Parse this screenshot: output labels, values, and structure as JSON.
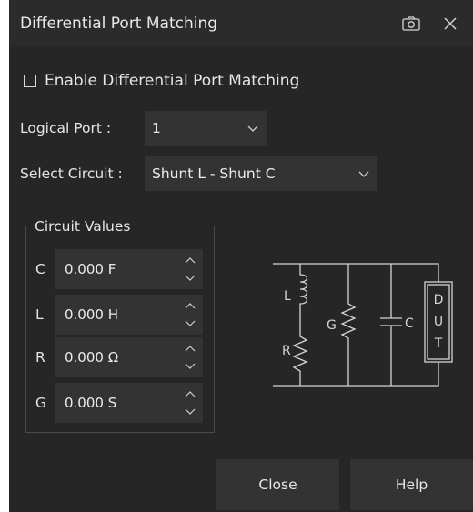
{
  "window": {
    "title": "Differential Port Matching"
  },
  "enable": {
    "label": "Enable Differential Port Matching",
    "checked": false
  },
  "logical_port": {
    "label": "Logical Port :",
    "value": "1"
  },
  "select_circuit": {
    "label": "Select Circuit :",
    "value": "Shunt L - Shunt C"
  },
  "circuit_values": {
    "title": "Circuit Values",
    "params": [
      {
        "name": "C",
        "value": "0.000 F"
      },
      {
        "name": "L",
        "value": "0.000 H"
      },
      {
        "name": "R",
        "value": "0.000 Ω"
      },
      {
        "name": "G",
        "value": "0.000 S"
      }
    ]
  },
  "diagram": {
    "labels": {
      "l": "L",
      "r": "R",
      "g": "G",
      "c": "C",
      "dut": [
        "D",
        "U",
        "T"
      ]
    }
  },
  "buttons": {
    "close": "Close",
    "help": "Help"
  },
  "icons": {
    "snapshot": "camera-icon",
    "close": "close-icon"
  }
}
